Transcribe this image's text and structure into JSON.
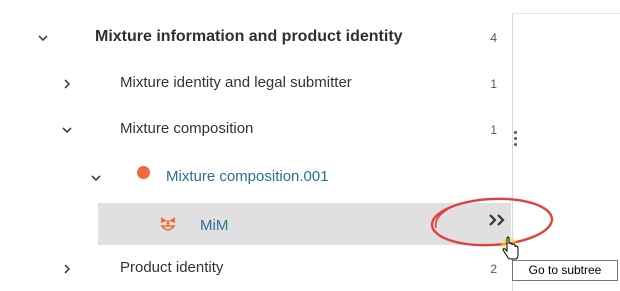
{
  "tree": {
    "section": {
      "label": "Mixture information and product identity",
      "count": "4",
      "chevron": "chevron-down-icon"
    },
    "items": [
      {
        "label": "Mixture identity and legal submitter",
        "count": "1",
        "chevron": "chevron-right-icon"
      },
      {
        "label": "Mixture composition",
        "count": "1",
        "chevron": "chevron-down-icon"
      }
    ],
    "record": {
      "label": "Mixture composition.001",
      "dot_color": "#f26a3b",
      "chevron": "chevron-down-icon"
    },
    "selected": {
      "label": "MiM",
      "icon": "mim-icon",
      "background": "#e0e0e0",
      "action_icon": "double-chevron-right-icon"
    },
    "last_item": {
      "label": "Product identity",
      "count": "2",
      "chevron": "chevron-right-icon"
    }
  },
  "tooltip": {
    "text": "Go to subtree"
  },
  "colors": {
    "link": "#2a7097",
    "annotation_ring": "#e0413d",
    "pointer": "#f5e43a"
  }
}
